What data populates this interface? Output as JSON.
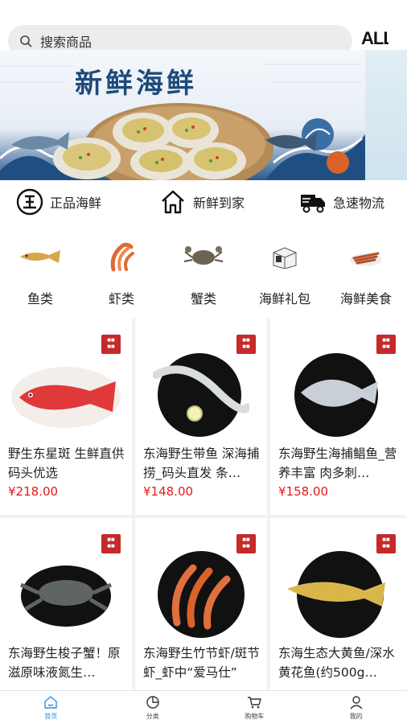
{
  "search": {
    "placeholder": "搜索商品",
    "icon": "search-icon"
  },
  "all_button": {
    "label": "ALL"
  },
  "banner": {
    "title": "新鲜海鲜"
  },
  "features": [
    {
      "icon": "authentic-icon",
      "label": "正品海鲜"
    },
    {
      "icon": "home-delivery-icon",
      "label": "新鲜到家"
    },
    {
      "icon": "truck-icon",
      "label": "急速物流"
    }
  ],
  "categories": [
    {
      "label": "鱼类",
      "icon": "fish-icon"
    },
    {
      "label": "虾类",
      "icon": "shrimp-icon"
    },
    {
      "label": "蟹类",
      "icon": "crab-icon"
    },
    {
      "label": "海鲜礼包",
      "icon": "gift-box-icon"
    },
    {
      "label": "海鲜美食",
      "icon": "seafood-dish-icon"
    }
  ],
  "products": [
    {
      "title": "野生东星斑 生鲜直供 码头优选",
      "price": "¥218.00"
    },
    {
      "title": "东海野生带鱼 深海捕捞_码头直发 条…",
      "price": "¥148.00"
    },
    {
      "title": "东海野生海捕鲳鱼_营养丰富 肉多刺…",
      "price": "¥158.00"
    },
    {
      "title": "东海野生梭子蟹！原滋原味液氮生…",
      "price": ""
    },
    {
      "title": "东海野生竹节虾/斑节虾_虾中“爱马仕”",
      "price": ""
    },
    {
      "title": "东海生态大黄鱼/深水黄花鱼(约500g…",
      "price": ""
    }
  ],
  "tabbar": [
    {
      "label": "首页",
      "icon": "home-icon",
      "active": true
    },
    {
      "label": "分类",
      "icon": "category-icon",
      "active": false
    },
    {
      "label": "购物车",
      "icon": "cart-icon",
      "active": false
    },
    {
      "label": "我的",
      "icon": "user-icon",
      "active": false
    }
  ],
  "colors": {
    "accent": "#2f8fe0",
    "price": "#e21b1b",
    "stamp": "#c42a2a",
    "banner_title": "#1e4a7a"
  }
}
